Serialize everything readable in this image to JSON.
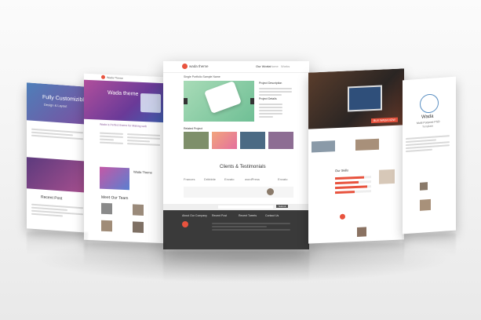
{
  "left_far": {
    "hero_title": "Fully Customizible",
    "hero_sub": "Design & Layout",
    "section_title": "Recent Post"
  },
  "left_mid": {
    "brand": "Wada Theme",
    "hero_title": "Wada theme",
    "tagline": "Wada is Perfect theme for Making web",
    "section_title": "Meet Our Team",
    "side_title": "Wada Theme"
  },
  "center": {
    "brand": "wada theme",
    "nav": [
      "Our Works",
      "Home",
      "Works"
    ],
    "breadcrumb": "Single Portfolio Sample Name",
    "project_desc_title": "Project Description",
    "project_details_title": "Project Details",
    "related_title": "Related Project",
    "clients_title": "Clients & Testimonials",
    "clients": [
      "Frances",
      "Dribbble",
      "Envato",
      "wordPress",
      "Envato"
    ],
    "footer_cols": [
      "About Our Company",
      "Recent Post",
      "Recent Tweets",
      "Contact Us"
    ],
    "subscribe": "Submit"
  },
  "right_mid": {
    "cta": "BUY WADA NOW",
    "section_title": "Our Skills"
  },
  "right_far": {
    "brand": "Wada",
    "tag": "Multi Purpose PSD",
    "sub": "Template"
  },
  "colors": {
    "accent": "#e8533e",
    "purple": "#8b3f9e",
    "footer": "#3a3a3a"
  }
}
